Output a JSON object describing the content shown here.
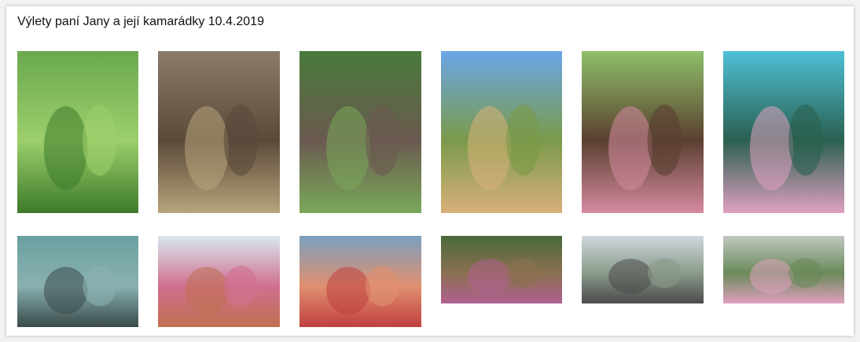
{
  "gallery": {
    "title": "Výlety paní Jany a její kamarádky 10.4.2019"
  },
  "photos": [
    {
      "id": "tea-plantation-selfie",
      "palette": [
        "#6aa84f",
        "#3d7a2a",
        "#9ccf6b"
      ]
    },
    {
      "id": "elephant-woman",
      "palette": [
        "#8b7b6b",
        "#b8a47c",
        "#5a4a3a"
      ]
    },
    {
      "id": "elephant-riders",
      "palette": [
        "#4a7a3a",
        "#7aa85a",
        "#6a5a50"
      ]
    },
    {
      "id": "sigiriya-rock",
      "palette": [
        "#6ba6e6",
        "#d9b07a",
        "#7a9a4a"
      ]
    },
    {
      "id": "woman-with-elder",
      "palette": [
        "#8fc06a",
        "#d68aa0",
        "#5a4030"
      ]
    },
    {
      "id": "child-train-selfie",
      "palette": [
        "#4ec0d6",
        "#e0a0c0",
        "#2a6050"
      ]
    },
    {
      "id": "elephant-bath",
      "palette": [
        "#6aa0a0",
        "#3a4a4a",
        "#8ab0b0"
      ]
    },
    {
      "id": "viewpoint-selfie",
      "palette": [
        "#d8e8f0",
        "#c07050",
        "#d07090"
      ]
    },
    {
      "id": "boat-ride",
      "palette": [
        "#7aa0c0",
        "#c04040",
        "#e09070"
      ]
    },
    {
      "id": "railway-track",
      "palette": [
        "#4a6a3a",
        "#b06090",
        "#8a7050"
      ]
    },
    {
      "id": "jeep-roadside",
      "palette": [
        "#d0d8e0",
        "#4a4a4a",
        "#8a9a8a"
      ]
    },
    {
      "id": "ella-station",
      "palette": [
        "#c0c8c0",
        "#e0a0c0",
        "#6a8a5a"
      ]
    }
  ]
}
